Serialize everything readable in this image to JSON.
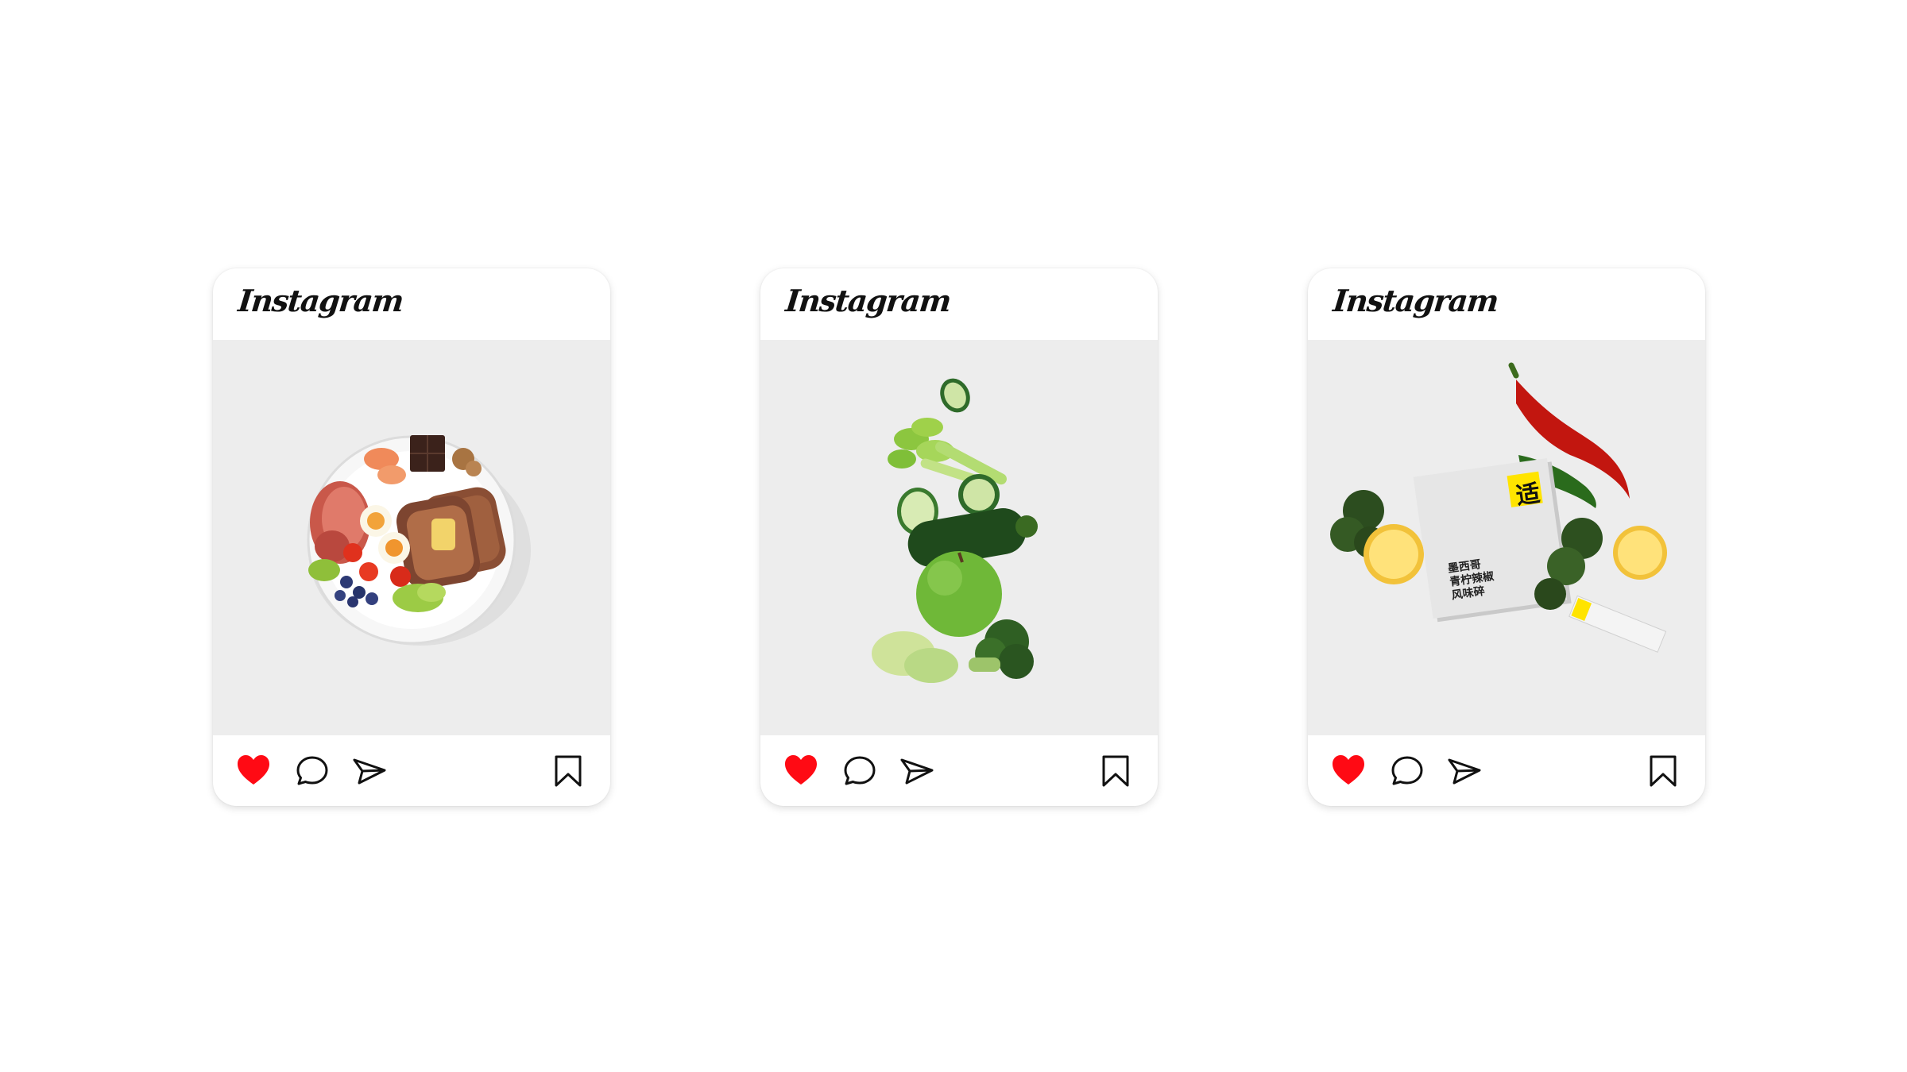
{
  "posts": [
    {
      "brand": "Instagram",
      "photo_subject": "plate-of-breakfast",
      "liked": true,
      "actions": [
        "like-icon",
        "comment-icon",
        "share-icon",
        "bookmark-icon"
      ]
    },
    {
      "brand": "Instagram",
      "photo_subject": "stacked-green-vegetables",
      "liked": true,
      "actions": [
        "like-icon",
        "comment-icon",
        "share-icon",
        "bookmark-icon"
      ]
    },
    {
      "brand": "Instagram",
      "photo_subject": "seasoning-box-with-chili-lemon-kale",
      "liked": true,
      "actions": [
        "like-icon",
        "comment-icon",
        "share-icon",
        "bookmark-icon"
      ],
      "product": {
        "badge": "适",
        "name_lines": [
          "墨西哥",
          "青柠辣椒",
          "风味碎"
        ]
      }
    }
  ],
  "colors": {
    "like": "#ff0a14",
    "photo_bg": "#ededed",
    "badge": "#ffe400"
  }
}
